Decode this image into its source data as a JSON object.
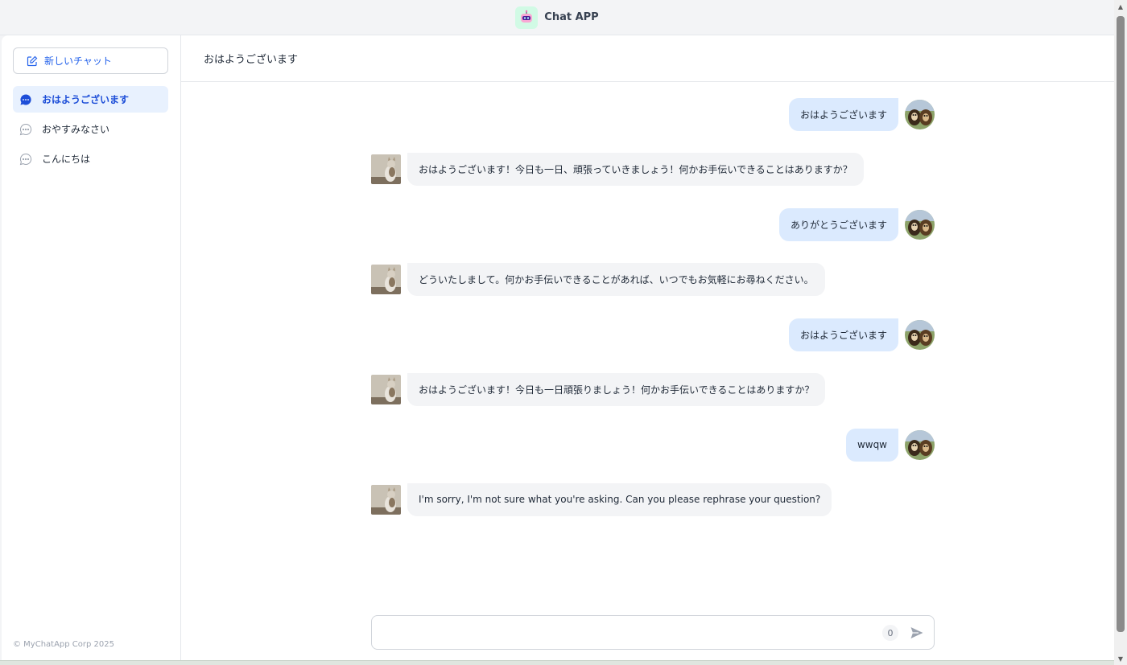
{
  "app": {
    "title": "Chat APP",
    "logo_icon": "robot-icon",
    "accent_color": "#2563eb"
  },
  "sidebar": {
    "new_chat_label": "新しいチャット",
    "items": [
      {
        "label": "おはようございます",
        "active": true
      },
      {
        "label": "おやすみなさい",
        "active": false
      },
      {
        "label": "こんにちは",
        "active": false
      }
    ],
    "copyright": "© MyChatApp Corp 2025"
  },
  "main": {
    "header_title": "おはようございます",
    "messages": [
      {
        "role": "user",
        "text": "おはようございます"
      },
      {
        "role": "bot",
        "text": "おはようございます！今日も一日、頑張っていきましょう！何かお手伝いできることはありますか？"
      },
      {
        "role": "user",
        "text": "ありがとうございます"
      },
      {
        "role": "bot",
        "text": "どういたしまして。何かお手伝いできることがあれば、いつでもお気軽にお尋ねください。"
      },
      {
        "role": "user",
        "text": "おはようございます"
      },
      {
        "role": "bot",
        "text": "おはようございます！今日も一日頑張りましょう！何かお手伝いできることはありますか？"
      },
      {
        "role": "user",
        "text": "wwqw"
      },
      {
        "role": "bot",
        "text": "I'm sorry, I'm not sure what you're asking. Can you please rephrase your question?"
      }
    ]
  },
  "composer": {
    "value": "",
    "placeholder": "",
    "char_count": "0",
    "send_icon": "send-icon"
  }
}
